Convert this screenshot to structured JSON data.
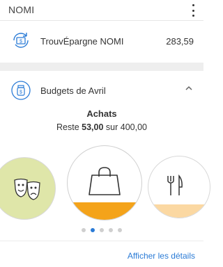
{
  "header": {
    "title": "NOMI",
    "menu_icon": "kebab-menu-icon"
  },
  "savings": {
    "icon": "savings-transfer-icon",
    "name": "TrouvÉpargne NOMI",
    "amount": "283,59"
  },
  "budgets": {
    "icon": "budget-jar-icon",
    "title": "Budgets de Avril",
    "toggle_icon": "chevron-up-icon",
    "current_category": {
      "name": "Achats",
      "remaining_prefix": "Reste",
      "remaining": "53,00",
      "of_text": "sur",
      "total": "400,00",
      "spent_fraction": 0.2325,
      "icon": "shopping-bag-icon"
    },
    "prev_category": {
      "icon": "theater-masks-icon"
    },
    "next_category": {
      "icon": "fork-knife-icon",
      "spent_fraction": 0.22
    },
    "page_dots": 5,
    "active_dot": 1,
    "details_link": "Afficher les détails"
  },
  "colors": {
    "accent": "#2a7bd6",
    "main_fill": "#f4a31a",
    "next_fill": "#fbd8a2",
    "prev_bg": "#dfe6a9"
  }
}
